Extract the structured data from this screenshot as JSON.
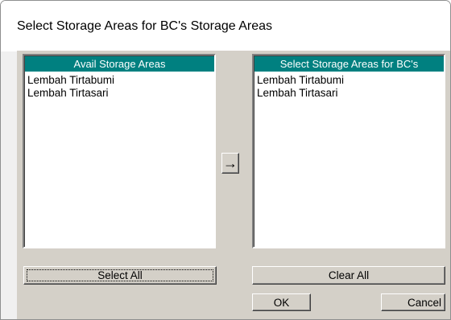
{
  "window": {
    "title": "Select Storage Areas for BC's Storage Areas"
  },
  "avail_list": {
    "header": "Avail Storage Areas",
    "items": [
      "Lembah Tirtabumi",
      "Lembah Tirtasari"
    ]
  },
  "selected_list": {
    "header": "Select Storage Areas for BC's",
    "items": [
      "Lembah Tirtabumi",
      "Lembah Tirtasari"
    ]
  },
  "buttons": {
    "move_right": "→",
    "select_all": "Select All",
    "clear_all": "Clear All",
    "ok": "OK",
    "cancel": "Cancel"
  },
  "colors": {
    "list_header_bg": "#008080",
    "dialog_face": "#d4d0c8"
  }
}
